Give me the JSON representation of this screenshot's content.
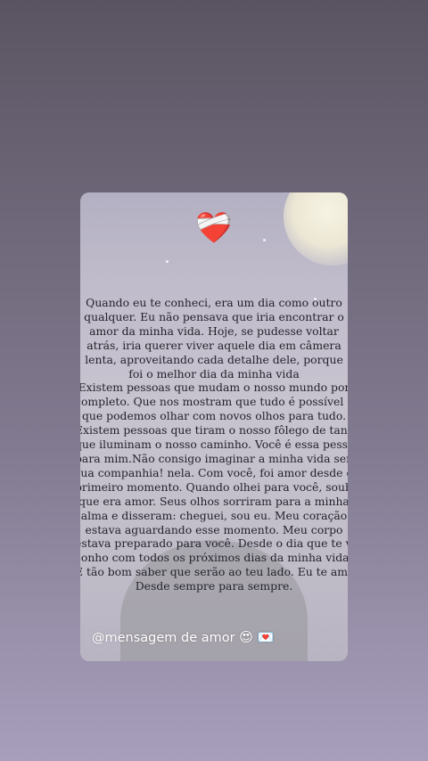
{
  "post": {
    "heart_icon": "heart-with-bandage",
    "heart_glyph": "❤️‍🩹",
    "message_lines": [
      "Quando eu te conheci, era um dia como outro",
      "qualquer. Eu não pensava que iria encontrar o",
      "amor da minha vida. Hoje, se pudesse voltar",
      "atrás, iria querer viver aquele dia em câmera",
      "lenta, aproveitando cada detalhe dele, porque",
      "foi o melhor dia da minha vida",
      "Existem pessoas que mudam o nosso mundo por",
      "completo. Que nos mostram que tudo é possível e",
      "que podemos olhar com novos olhos para tudo.",
      "Existem pessoas que tiram o nosso fôlego de tanto",
      "que iluminam o nosso caminho. Você é essa pessoa",
      "para mim.Não consigo imaginar a minha vida sem",
      "sua companhia! nela. Com você, foi amor desde o",
      "primeiro momento. Quando olhei para você, soube",
      "que era amor. Seus olhos sorriram para a minha",
      "alma e disseram: cheguei, sou eu. Meu coração",
      "estava aguardando esse momento. Meu corpo",
      "estava preparado para você. Desde o dia que te vi,",
      "sonho com todos os próximos dias da minha vida.",
      "É tão bom saber que serão ao teu lado. Eu te amo.",
      "Desde sempre para sempre."
    ],
    "signature": "@mensagem de amor",
    "signature_emoji_1": "😍",
    "signature_emoji_2": "💌"
  }
}
